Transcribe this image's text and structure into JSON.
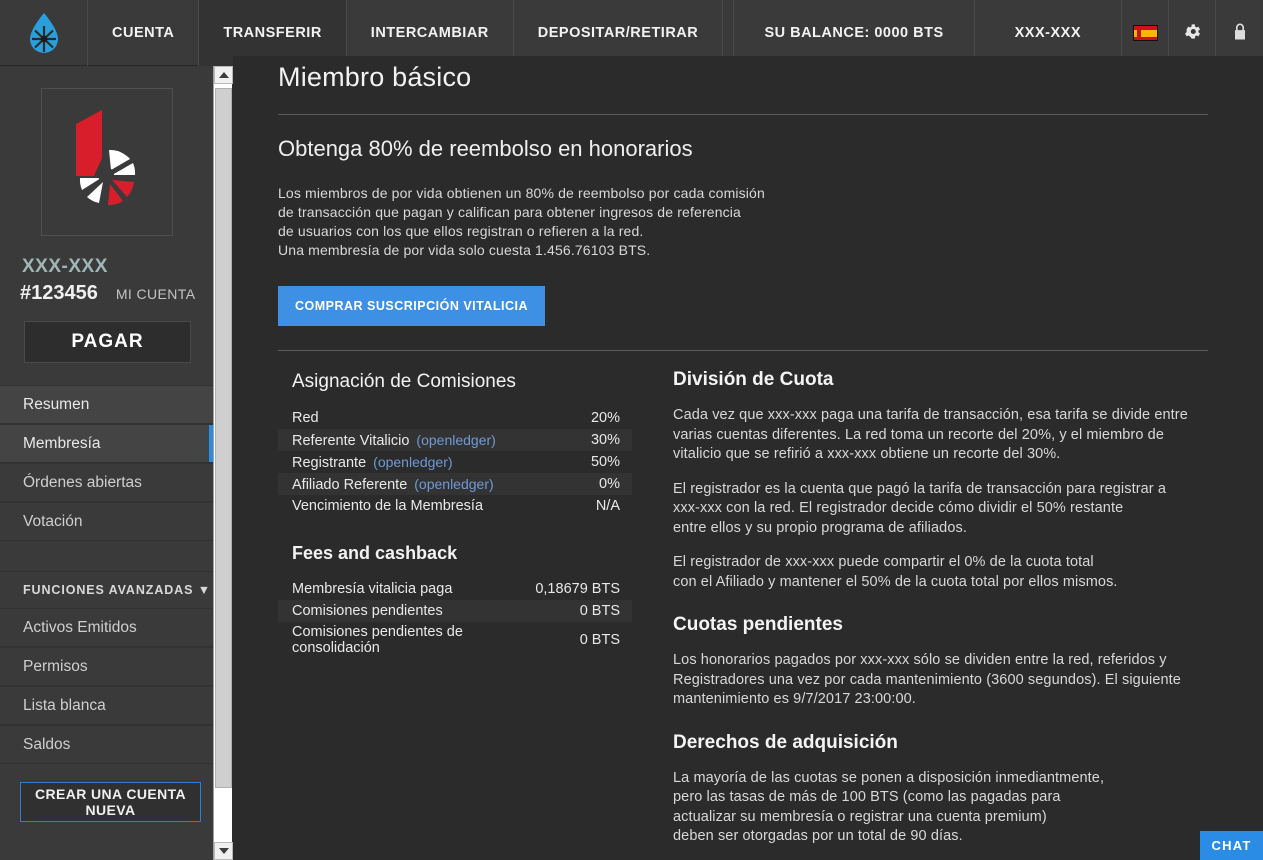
{
  "header": {
    "logo_icon": "bitshares-droplet-icon",
    "tabs": [
      {
        "label": "CUENTA",
        "active": false
      },
      {
        "label": "TRANSFERIR",
        "active": true
      },
      {
        "label": "INTERCAMBIAR",
        "active": false
      },
      {
        "label": "DEPOSITAR/RETIRAR",
        "active": false
      }
    ],
    "balance_label": "SU BALANCE: 0000 BTS",
    "account_label": "XXX-XXX",
    "flag_icon": "spain-flag-icon",
    "settings_icon": "gear-icon",
    "lock_icon": "lock-icon"
  },
  "sidebar": {
    "avatar_icon": "account-avatar-icon",
    "account_name": "XXX-XXX",
    "account_id": "#123456",
    "account_sub": "MI CUENTA",
    "pay_button": "PAGAR",
    "items": [
      {
        "label": "Resumen"
      },
      {
        "label": "Membresía"
      },
      {
        "label": "Órdenes abiertas"
      },
      {
        "label": "Votación"
      }
    ],
    "advanced_label": "FUNCIONES AVANZADAS ▼",
    "advanced_items": [
      {
        "label": "Activos Emitidos"
      },
      {
        "label": "Permisos"
      },
      {
        "label": "Lista blanca"
      },
      {
        "label": "Saldos"
      }
    ],
    "new_account_button": "CREAR UNA CUENTA NUEVA"
  },
  "main": {
    "page_title": "Miembro básico",
    "promo_heading": "Obtenga 80% de reembolso en honorarios",
    "promo_body": "Los miembros de por vida obtienen un 80% de reembolso por cada comisión\nde transacción que pagan y califican para obtener ingresos de referencia\nde usuarios con los que ellos registran o refieren a la red.\nUna membresía de por vida solo cuesta 1.456.76103 BTS.",
    "buy_button": "COMPRAR SUSCRIPCIÓN VITALICIA",
    "commissions": {
      "title": "Asignación de Comisiones",
      "rows": [
        {
          "key": "Red",
          "sub": "",
          "value": "20%"
        },
        {
          "key": "Referente Vitalicio",
          "sub": "(openledger)",
          "value": "30%"
        },
        {
          "key": "Registrante",
          "sub": "(openledger)",
          "value": "50%"
        },
        {
          "key": "Afiliado Referente",
          "sub": "(openledger)",
          "value": "0%"
        },
        {
          "key": "Vencimiento de la Membresía",
          "sub": "",
          "value": "N/A"
        }
      ]
    },
    "fees": {
      "title": "Fees and cashback",
      "rows": [
        {
          "key": "Membresía vitalicia paga",
          "value": "0,18679 BTS"
        },
        {
          "key": "Comisiones pendientes",
          "value": "0 BTS"
        },
        {
          "key": "Comisiones pendientes de\nconsolidación",
          "value": "0 BTS"
        }
      ]
    },
    "right": {
      "split_title": "División de Cuota",
      "split_p1": "Cada vez que xxx-xxx paga una tarifa de transacción, esa tarifa se divide entre\nvarias cuentas diferentes. La red toma un recorte del 20%, y el miembro de\nvitalicio que se refirió a xxx-xxx obtiene un recorte del 30%.",
      "split_p2": "El registrador es la cuenta que pagó la tarifa de transacción para registrar a\nxxx-xxx con la red. El registrador decide cómo dividir el 50% restante\nentre ellos y su propio programa de afiliados.",
      "split_p3": "El registrador de xxx-xxx puede compartir el 0% de la cuota total\ncon el Afiliado y mantener el 50% de la cuota total por ellos mismos.",
      "pending_title": "Cuotas pendientes",
      "pending_p1": "Los honorarios pagados por xxx-xxx sólo se dividen entre la red, referidos y\nRegistradores una vez por cada mantenimiento (3600 segundos). El siguiente\nmantenimiento es 9/7/2017 23:00:00.",
      "vesting_title": "Derechos de adquisición",
      "vesting_p1": "La mayoría de las cuotas se ponen a disposición inmediantmente,\npero las tasas de más de 100 BTS (como las pagadas para\nactualizar su membresía o registrar una cuenta premium)\ndeben ser otorgadas por un total de 90 días."
    }
  },
  "chat": {
    "label": "CHAT"
  },
  "colors": {
    "accent_blue": "#3d90e3",
    "link_blue": "#6f9ad6",
    "active_marker": "#2b8ce5",
    "header_bg": "#3a3a3a",
    "main_bg": "#2b2b2b"
  }
}
